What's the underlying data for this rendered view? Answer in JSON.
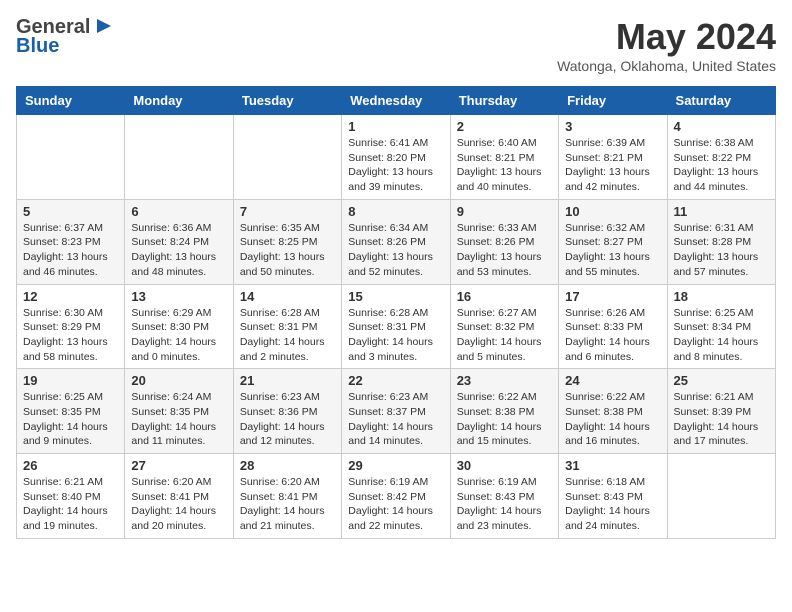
{
  "header": {
    "logo_general": "General",
    "logo_blue": "Blue",
    "month_title": "May 2024",
    "location": "Watonga, Oklahoma, United States"
  },
  "days_of_week": [
    "Sunday",
    "Monday",
    "Tuesday",
    "Wednesday",
    "Thursday",
    "Friday",
    "Saturday"
  ],
  "weeks": [
    [
      {
        "day": "",
        "info": ""
      },
      {
        "day": "",
        "info": ""
      },
      {
        "day": "",
        "info": ""
      },
      {
        "day": "1",
        "info": "Sunrise: 6:41 AM\nSunset: 8:20 PM\nDaylight: 13 hours\nand 39 minutes."
      },
      {
        "day": "2",
        "info": "Sunrise: 6:40 AM\nSunset: 8:21 PM\nDaylight: 13 hours\nand 40 minutes."
      },
      {
        "day": "3",
        "info": "Sunrise: 6:39 AM\nSunset: 8:21 PM\nDaylight: 13 hours\nand 42 minutes."
      },
      {
        "day": "4",
        "info": "Sunrise: 6:38 AM\nSunset: 8:22 PM\nDaylight: 13 hours\nand 44 minutes."
      }
    ],
    [
      {
        "day": "5",
        "info": "Sunrise: 6:37 AM\nSunset: 8:23 PM\nDaylight: 13 hours\nand 46 minutes."
      },
      {
        "day": "6",
        "info": "Sunrise: 6:36 AM\nSunset: 8:24 PM\nDaylight: 13 hours\nand 48 minutes."
      },
      {
        "day": "7",
        "info": "Sunrise: 6:35 AM\nSunset: 8:25 PM\nDaylight: 13 hours\nand 50 minutes."
      },
      {
        "day": "8",
        "info": "Sunrise: 6:34 AM\nSunset: 8:26 PM\nDaylight: 13 hours\nand 52 minutes."
      },
      {
        "day": "9",
        "info": "Sunrise: 6:33 AM\nSunset: 8:26 PM\nDaylight: 13 hours\nand 53 minutes."
      },
      {
        "day": "10",
        "info": "Sunrise: 6:32 AM\nSunset: 8:27 PM\nDaylight: 13 hours\nand 55 minutes."
      },
      {
        "day": "11",
        "info": "Sunrise: 6:31 AM\nSunset: 8:28 PM\nDaylight: 13 hours\nand 57 minutes."
      }
    ],
    [
      {
        "day": "12",
        "info": "Sunrise: 6:30 AM\nSunset: 8:29 PM\nDaylight: 13 hours\nand 58 minutes."
      },
      {
        "day": "13",
        "info": "Sunrise: 6:29 AM\nSunset: 8:30 PM\nDaylight: 14 hours\nand 0 minutes."
      },
      {
        "day": "14",
        "info": "Sunrise: 6:28 AM\nSunset: 8:31 PM\nDaylight: 14 hours\nand 2 minutes."
      },
      {
        "day": "15",
        "info": "Sunrise: 6:28 AM\nSunset: 8:31 PM\nDaylight: 14 hours\nand 3 minutes."
      },
      {
        "day": "16",
        "info": "Sunrise: 6:27 AM\nSunset: 8:32 PM\nDaylight: 14 hours\nand 5 minutes."
      },
      {
        "day": "17",
        "info": "Sunrise: 6:26 AM\nSunset: 8:33 PM\nDaylight: 14 hours\nand 6 minutes."
      },
      {
        "day": "18",
        "info": "Sunrise: 6:25 AM\nSunset: 8:34 PM\nDaylight: 14 hours\nand 8 minutes."
      }
    ],
    [
      {
        "day": "19",
        "info": "Sunrise: 6:25 AM\nSunset: 8:35 PM\nDaylight: 14 hours\nand 9 minutes."
      },
      {
        "day": "20",
        "info": "Sunrise: 6:24 AM\nSunset: 8:35 PM\nDaylight: 14 hours\nand 11 minutes."
      },
      {
        "day": "21",
        "info": "Sunrise: 6:23 AM\nSunset: 8:36 PM\nDaylight: 14 hours\nand 12 minutes."
      },
      {
        "day": "22",
        "info": "Sunrise: 6:23 AM\nSunset: 8:37 PM\nDaylight: 14 hours\nand 14 minutes."
      },
      {
        "day": "23",
        "info": "Sunrise: 6:22 AM\nSunset: 8:38 PM\nDaylight: 14 hours\nand 15 minutes."
      },
      {
        "day": "24",
        "info": "Sunrise: 6:22 AM\nSunset: 8:38 PM\nDaylight: 14 hours\nand 16 minutes."
      },
      {
        "day": "25",
        "info": "Sunrise: 6:21 AM\nSunset: 8:39 PM\nDaylight: 14 hours\nand 17 minutes."
      }
    ],
    [
      {
        "day": "26",
        "info": "Sunrise: 6:21 AM\nSunset: 8:40 PM\nDaylight: 14 hours\nand 19 minutes."
      },
      {
        "day": "27",
        "info": "Sunrise: 6:20 AM\nSunset: 8:41 PM\nDaylight: 14 hours\nand 20 minutes."
      },
      {
        "day": "28",
        "info": "Sunrise: 6:20 AM\nSunset: 8:41 PM\nDaylight: 14 hours\nand 21 minutes."
      },
      {
        "day": "29",
        "info": "Sunrise: 6:19 AM\nSunset: 8:42 PM\nDaylight: 14 hours\nand 22 minutes."
      },
      {
        "day": "30",
        "info": "Sunrise: 6:19 AM\nSunset: 8:43 PM\nDaylight: 14 hours\nand 23 minutes."
      },
      {
        "day": "31",
        "info": "Sunrise: 6:18 AM\nSunset: 8:43 PM\nDaylight: 14 hours\nand 24 minutes."
      },
      {
        "day": "",
        "info": ""
      }
    ]
  ]
}
